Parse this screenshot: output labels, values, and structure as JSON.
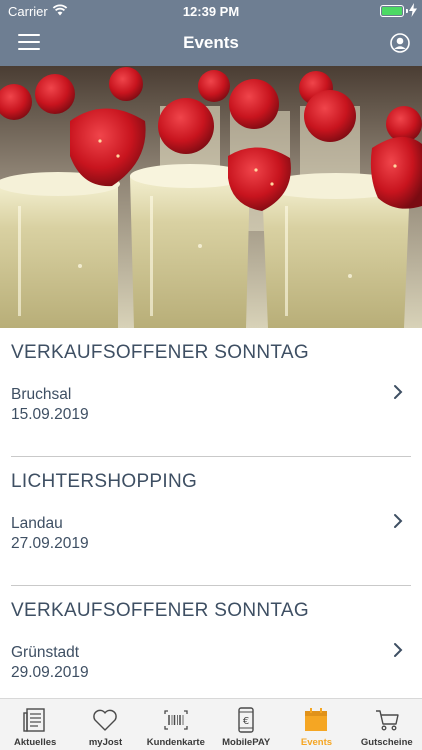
{
  "status": {
    "carrier": "Carrier",
    "time": "12:39 PM",
    "battery_level": 1.0
  },
  "nav": {
    "title": "Events"
  },
  "hero": {
    "alt": "Champagne glasses with strawberries"
  },
  "events": [
    {
      "title": "VERKAUFSOFFENER SONNTAG",
      "place": "Bruchsal",
      "date": "15.09.2019"
    },
    {
      "title": "LICHTERSHOPPING",
      "place": "Landau",
      "date": "27.09.2019"
    },
    {
      "title": "VERKAUFSOFFENER SONNTAG",
      "place": "Grünstadt",
      "date": "29.09.2019"
    }
  ],
  "tabs": [
    {
      "label": "Aktuelles",
      "icon": "newspaper-icon"
    },
    {
      "label": "myJost",
      "icon": "heart-icon"
    },
    {
      "label": "Kundenkarte",
      "icon": "barcode-icon"
    },
    {
      "label": "MobilePAY",
      "icon": "euro-phone-icon"
    },
    {
      "label": "Events",
      "icon": "calendar-icon",
      "active": true
    },
    {
      "label": "Gutscheine",
      "icon": "cart-icon"
    }
  ],
  "colors": {
    "header": "#6e7e92",
    "text": "#3e4f63",
    "active_tab": "#f5a623",
    "battery": "#4cd964"
  }
}
